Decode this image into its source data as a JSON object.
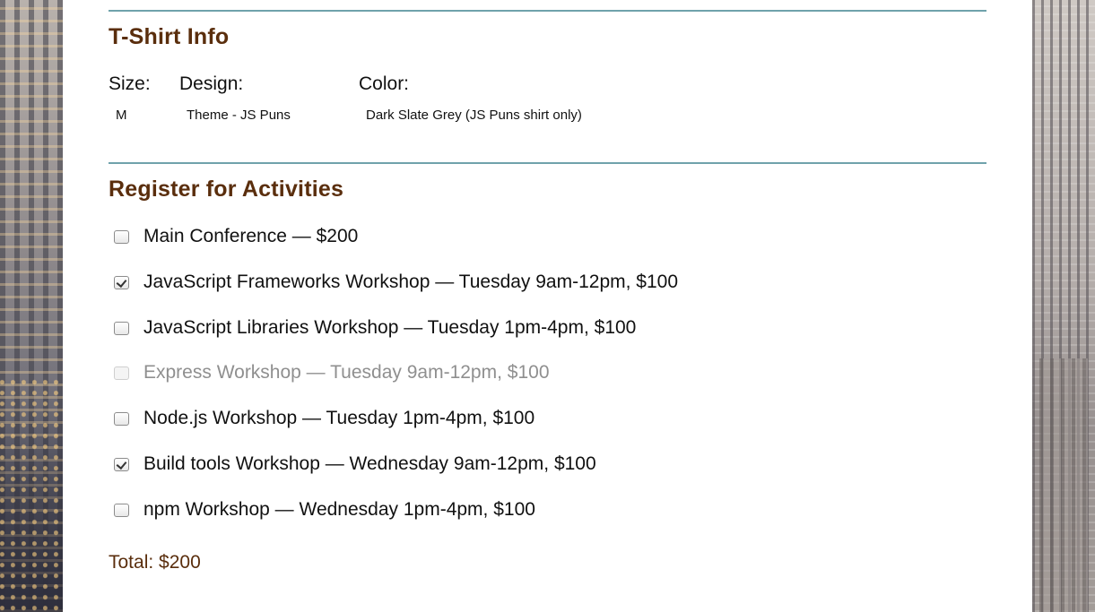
{
  "tshirt": {
    "title": "T-Shirt Info",
    "size_label": "Size:",
    "design_label": "Design:",
    "color_label": "Color:",
    "size_value": "M",
    "design_value": "Theme - JS Puns",
    "color_value": "Dark Slate Grey (JS Puns shirt only)"
  },
  "activities": {
    "title": "Register for Activities",
    "items": [
      {
        "label": "Main Conference — $200",
        "checked": false,
        "disabled": false
      },
      {
        "label": "JavaScript Frameworks Workshop — Tuesday 9am-12pm, $100",
        "checked": true,
        "disabled": false
      },
      {
        "label": "JavaScript Libraries Workshop — Tuesday 1pm-4pm, $100",
        "checked": false,
        "disabled": false
      },
      {
        "label": "Express Workshop — Tuesday 9am-12pm, $100",
        "checked": false,
        "disabled": true
      },
      {
        "label": "Node.js Workshop — Tuesday 1pm-4pm, $100",
        "checked": false,
        "disabled": false
      },
      {
        "label": "Build tools Workshop — Wednesday 9am-12pm, $100",
        "checked": true,
        "disabled": false
      },
      {
        "label": "npm Workshop — Wednesday 1pm-4pm, $100",
        "checked": false,
        "disabled": false
      }
    ]
  },
  "total": "Total: $200",
  "colors": {
    "heading": "#5a2e0d",
    "divider": "#6fa2ab",
    "disabled_text": "#8f8f8f"
  }
}
